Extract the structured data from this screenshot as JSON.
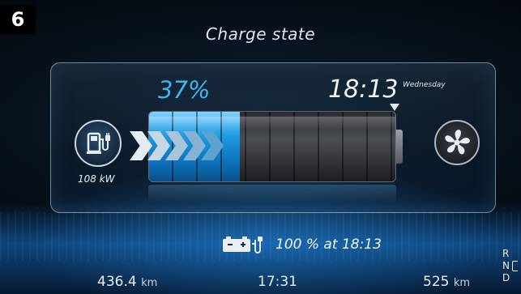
{
  "badge": "6",
  "header": {
    "title": "Charge state"
  },
  "charge": {
    "percent_label": "37%",
    "percent_value": 37,
    "time": "18:13",
    "weekday": "Wednesday",
    "power": "108 kW",
    "full_at_label": "100 % at 18:13"
  },
  "footer": {
    "odometer_value": "436.4",
    "odometer_unit": "km",
    "clock": "17:31",
    "range_value": "525",
    "range_unit": "km"
  },
  "gears": [
    "R",
    "N",
    "D"
  ],
  "icons": {
    "plug": "ev-charging-plug-icon",
    "fan": "fan-icon",
    "battery_full": "battery-charging-icon"
  },
  "colors": {
    "accent": "#3fb4f0",
    "fill": "#1e9be0",
    "text": "#e8eef4"
  }
}
